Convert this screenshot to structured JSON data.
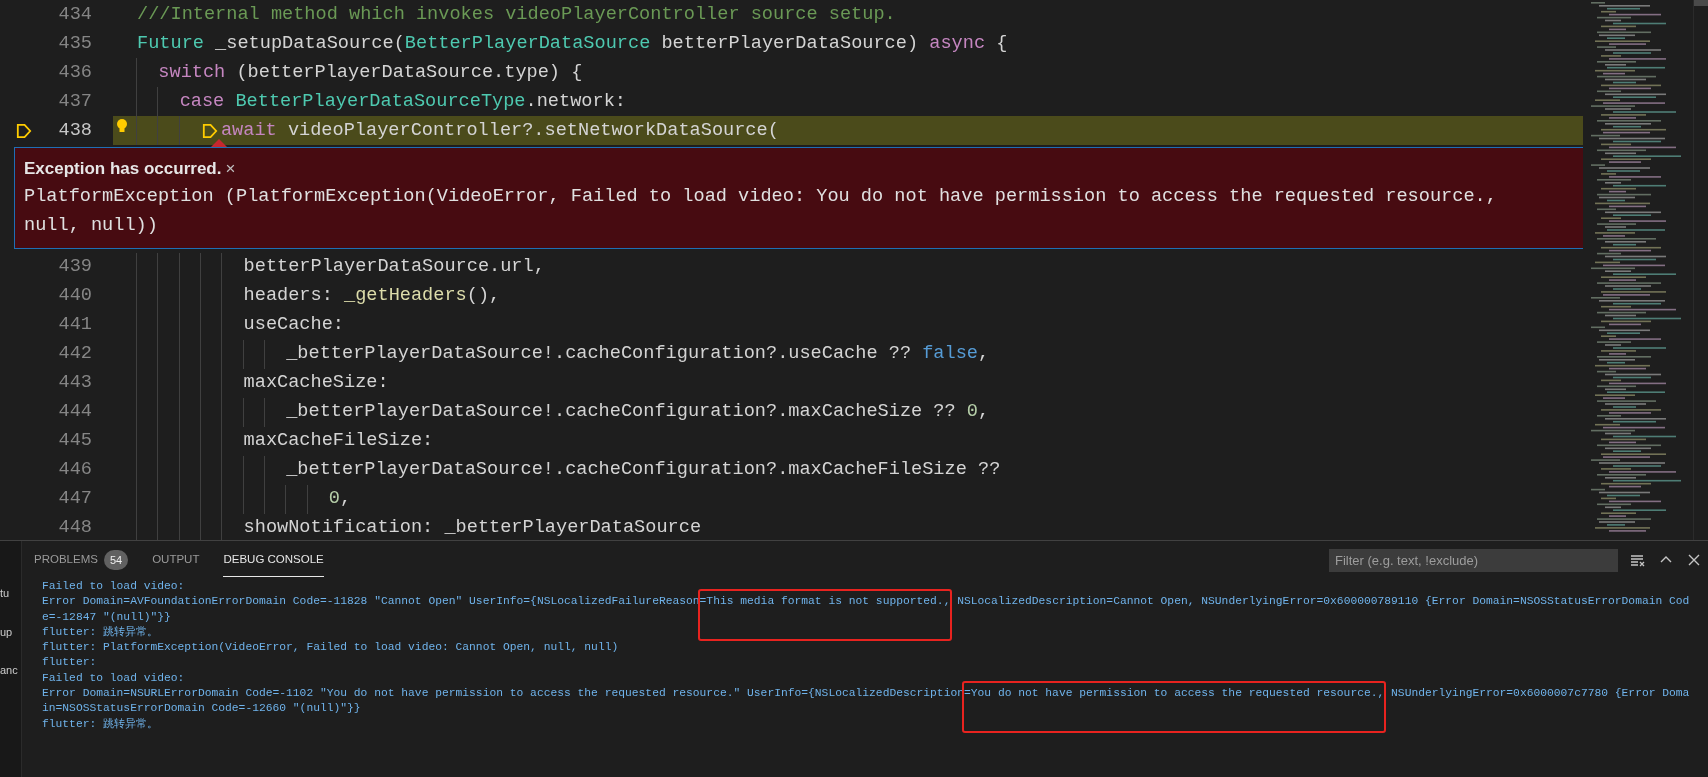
{
  "editor": {
    "lines": [
      {
        "number": "434",
        "current": false,
        "tokens": [
          {
            "kind": "comment",
            "text": "///Internal method which invokes videoPlayerController source setup."
          }
        ]
      },
      {
        "number": "435",
        "current": false,
        "continuation": false,
        "tokens": [
          {
            "kind": "type",
            "text": "Future"
          },
          {
            "kind": "plain",
            "text": " _setupDataSource("
          },
          {
            "kind": "type",
            "text": "BetterPlayerDataSource"
          },
          {
            "kind": "plain",
            "text": " betterPlayerDataSource) "
          },
          {
            "kind": "keyword",
            "text": "async"
          },
          {
            "kind": "plain",
            "text": " {"
          }
        ],
        "children": [
          {
            "number": "436",
            "current": false,
            "continuation": false,
            "tokens": [
              {
                "kind": "keyword",
                "text": "switch"
              },
              {
                "kind": "plain",
                "text": " (betterPlayerDataSource.type) {"
              }
            ],
            "children": [
              {
                "number": "437",
                "current": false,
                "continuation": false,
                "tokens": [
                  {
                    "kind": "keyword",
                    "text": "case "
                  },
                  {
                    "kind": "type",
                    "text": "BetterPlayerDataSourceType"
                  },
                  {
                    "kind": "plain",
                    "text": ".network:"
                  }
                ],
                "children": [
                  {
                    "number": "438",
                    "current": true,
                    "continuation": true,
                    "tokens": [
                      {
                        "kind": "keyword",
                        "text": "await"
                      },
                      {
                        "kind": "plain",
                        "text": " videoPlayerController?.setNetworkDataSource("
                      }
                    ],
                    "children": [
                      {
                        "number": "439",
                        "current": false,
                        "tokens": [
                          {
                            "kind": "plain",
                            "text": "betterPlayerDataSource.url,"
                          }
                        ]
                      },
                      {
                        "number": "440",
                        "current": false,
                        "tokens": [
                          {
                            "kind": "plain",
                            "text": "headers: "
                          },
                          {
                            "kind": "function",
                            "text": "_getHeaders"
                          },
                          {
                            "kind": "plain",
                            "text": "(),"
                          }
                        ]
                      },
                      {
                        "number": "441",
                        "current": false,
                        "continuation": true,
                        "tokens": [
                          {
                            "kind": "plain",
                            "text": "useCache:"
                          }
                        ],
                        "children": [
                          {
                            "number": "442",
                            "current": false,
                            "tokens": [
                              {
                                "kind": "plain",
                                "text": "_betterPlayerDataSource!.cacheConfiguration?.useCache ?? "
                              },
                              {
                                "kind": "literal",
                                "text": "false"
                              },
                              {
                                "kind": "plain",
                                "text": ","
                              }
                            ]
                          }
                        ]
                      },
                      {
                        "number": "443",
                        "current": false,
                        "continuation": true,
                        "tokens": [
                          {
                            "kind": "plain",
                            "text": "maxCacheSize:"
                          }
                        ],
                        "children": [
                          {
                            "number": "444",
                            "current": false,
                            "tokens": [
                              {
                                "kind": "plain",
                                "text": "_betterPlayerDataSource!.cacheConfiguration?.maxCacheSize ?? "
                              },
                              {
                                "kind": "number",
                                "text": "0"
                              },
                              {
                                "kind": "plain",
                                "text": ","
                              }
                            ]
                          }
                        ]
                      },
                      {
                        "number": "445",
                        "current": false,
                        "continuation": true,
                        "tokens": [
                          {
                            "kind": "plain",
                            "text": "maxCacheFileSize:"
                          }
                        ],
                        "children": [
                          {
                            "number": "446",
                            "current": false,
                            "continuation": true,
                            "tokens": [
                              {
                                "kind": "plain",
                                "text": "_betterPlayerDataSource!.cacheConfiguration?.maxCacheFileSize ??"
                              }
                            ],
                            "children": [
                              {
                                "number": "447",
                                "current": false,
                                "tokens": [
                                  {
                                    "kind": "number",
                                    "text": "0"
                                  },
                                  {
                                    "kind": "plain",
                                    "text": ","
                                  }
                                ]
                              }
                            ]
                          }
                        ]
                      },
                      {
                        "number": "448",
                        "current": false,
                        "tokens": [
                          {
                            "kind": "plain",
                            "text": "showNotification: _betterPlayerDataSource"
                          }
                        ]
                      }
                    ]
                  }
                ]
              }
            ]
          }
        ]
      }
    ],
    "exception": {
      "title": "Exception has occurred.",
      "close": "×",
      "message_lines": [
        "PlatformException (PlatformException(VideoError, Failed to load video: You do not have permission to access the requested resource.,",
        "null, null))"
      ]
    }
  },
  "sidebar_fragments": [
    "tu",
    "up",
    "anc"
  ],
  "panel": {
    "tabs": [
      {
        "label": "PROBLEMS",
        "count": "54",
        "selected": false
      },
      {
        "label": "OUTPUT",
        "selected": false
      },
      {
        "label": "DEBUG CONSOLE",
        "selected": true
      }
    ],
    "filter": {
      "placeholder": "Filter (e.g. text, !exclude)"
    },
    "console": {
      "lines": [
        {
          "segments": [
            {
              "text": "Failed to load video:"
            }
          ]
        },
        {
          "segments": [
            {
              "text": "Error Domain=AVFoundationErrorDomain Code=-11828 \"Cannot Open\" UserInfo={NSLocalizedFailureReason"
            },
            {
              "text": "=This media format is not supported.,",
              "boxed": true
            },
            {
              "text": " NSLocalizedDescription=Cannot Open, NSUnderlyingError=0x600000789110 {Error Domain=NSOSStatusErrorDomain Cod"
            }
          ]
        },
        {
          "segments": [
            {
              "text": "e=-12847 \"(null)\"}}"
            }
          ]
        },
        {
          "segments": [
            {
              "text": "flutter: 跳转异常。"
            }
          ]
        },
        {
          "segments": [
            {
              "text": "flutter: PlatformException(VideoError, Failed to load video: Cannot Open, null, null)"
            }
          ]
        },
        {
          "segments": [
            {
              "text": "flutter:"
            }
          ]
        },
        {
          "segments": [
            {
              "text": "Failed to load video:"
            }
          ]
        },
        {
          "segments": [
            {
              "text": "Error Domain=NSURLErrorDomain Code=-1102 \"You do not have permission to access the requested resource.\" UserInfo={NSLocalizedDescription"
            },
            {
              "text": "=You do not have permission to access the requested resource.,",
              "boxed": true
            },
            {
              "text": " NSUnderlyingError=0x6000007c7780 {Error Doma"
            }
          ]
        },
        {
          "segments": [
            {
              "text": "in=NSOSStatusErrorDomain Code=-12660 \"(null)\"}}"
            }
          ]
        },
        {
          "segments": [
            {
              "text": "flutter: 跳转异常。"
            }
          ]
        }
      ]
    }
  }
}
